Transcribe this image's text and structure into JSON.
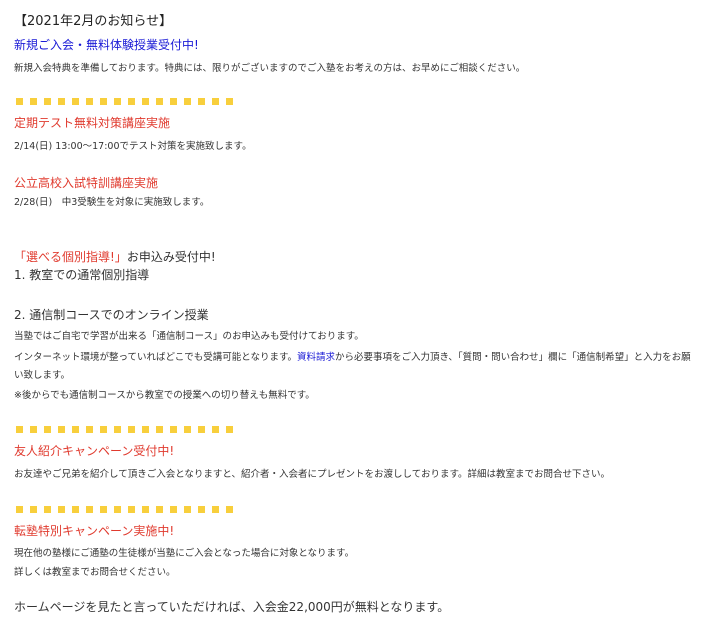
{
  "notice_title": "【2021年2月のお知らせ】",
  "enrollment": {
    "heading": "新規ご入会・無料体験授業受付中!",
    "body": "新規入会特典を準備しております。特典には、限りがございますのでご入塾をお考えの方は、お早めにご相談ください。"
  },
  "exam_course": {
    "heading": "定期テスト無料対策講座実施",
    "body": "2/14(日) 13:00〜17:00でテスト対策を実施致します。"
  },
  "highschool_course": {
    "heading": "公立高校入試特訓講座実施",
    "body": "2/28(日)　中3受験生を対象に実施致します。"
  },
  "guidance": {
    "heading_red": "「選べる個別指導!」",
    "heading_rest": "お申込み受付中!",
    "item1": "1. 教室での通常個別指導",
    "item2": "2. 通信制コースでのオンライン授業",
    "line1": "当塾ではご自宅で学習が出来る「通信制コース」のお申込みも受付けております。",
    "line2_a": "インターネット環境が整っていればどこでも受講可能となります。",
    "line2_link": "資料請求",
    "line2_b": "から必要事項をご入力頂き、「質問・問い合わせ」欄に「通信制希望」と入力をお願",
    "line3": "い致します。",
    "line4": "※後からでも通信制コースから教室での授業への切り替えも無料です。"
  },
  "referral": {
    "heading": "友人紹介キャンペーン受付中!",
    "body": "お友達やご兄弟を紹介して頂きご入会となりますと、紹介者・入会者にプレゼントをお渡ししております。詳細は教室までお問合せ下さい。"
  },
  "transfer": {
    "heading": "転塾特別キャンペーン実施中!",
    "body1": "現在他の塾様にご通塾の生徒様が当塾にご入会となった場合に対象となります。",
    "body2": "詳しくは教室までお問合せください。"
  },
  "homepage_offer": "ホームページを見たと言っていただければ、入会金22,000円が無料となります。",
  "colors": {
    "blue": "#1a1ad6",
    "red": "#e03a2e",
    "dot": "#f8cf3c"
  }
}
